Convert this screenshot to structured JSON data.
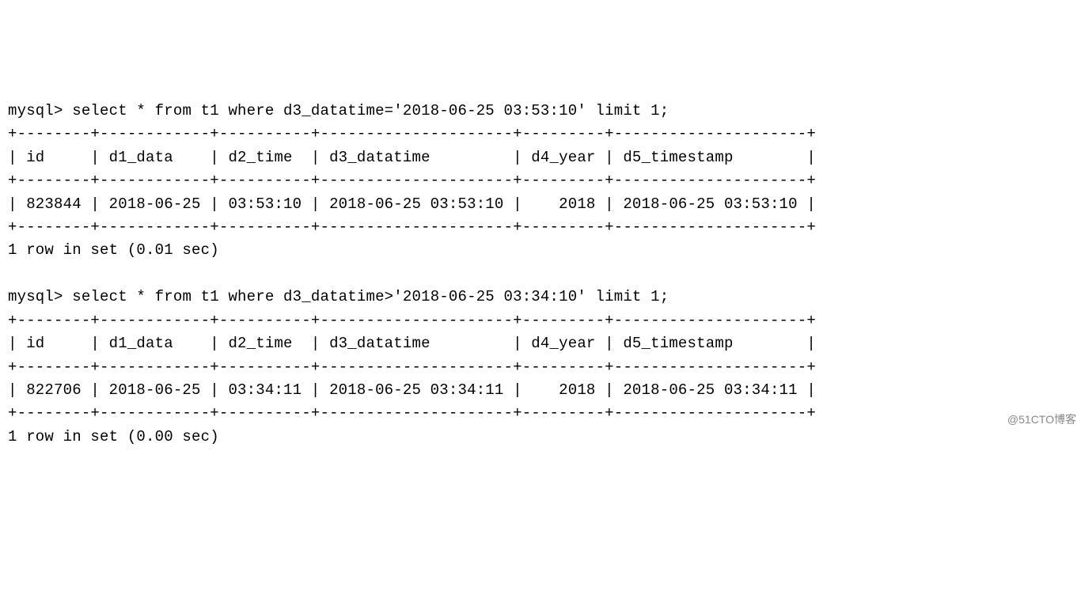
{
  "query1": {
    "prompt": "mysql> ",
    "sql": "select * from t1 where d3_datatime='2018-06-25 03:53:10' limit 1;",
    "border": "+--------+------------+----------+---------------------+---------+---------------------+",
    "header": "| id     | d1_data    | d2_time  | d3_datatime         | d4_year | d5_timestamp        |",
    "row": "| 823844 | 2018-06-25 | 03:53:10 | 2018-06-25 03:53:10 |    2018 | 2018-06-25 03:53:10 |",
    "footer": "1 row in set (0.01 sec)",
    "columns": [
      "id",
      "d1_data",
      "d2_time",
      "d3_datatime",
      "d4_year",
      "d5_timestamp"
    ],
    "values": [
      "823844",
      "2018-06-25",
      "03:53:10",
      "2018-06-25 03:53:10",
      "2018",
      "2018-06-25 03:53:10"
    ]
  },
  "query2": {
    "prompt": "mysql> ",
    "sql": "select * from t1 where d3_datatime>'2018-06-25 03:34:10' limit 1;",
    "border": "+--------+------------+----------+---------------------+---------+---------------------+",
    "header": "| id     | d1_data    | d2_time  | d3_datatime         | d4_year | d5_timestamp        |",
    "row": "| 822706 | 2018-06-25 | 03:34:11 | 2018-06-25 03:34:11 |    2018 | 2018-06-25 03:34:11 |",
    "footer": "1 row in set (0.00 sec)",
    "columns": [
      "id",
      "d1_data",
      "d2_time",
      "d3_datatime",
      "d4_year",
      "d5_timestamp"
    ],
    "values": [
      "822706",
      "2018-06-25",
      "03:34:11",
      "2018-06-25 03:34:11",
      "2018",
      "2018-06-25 03:34:11"
    ]
  },
  "watermark": "@51CTO博客"
}
